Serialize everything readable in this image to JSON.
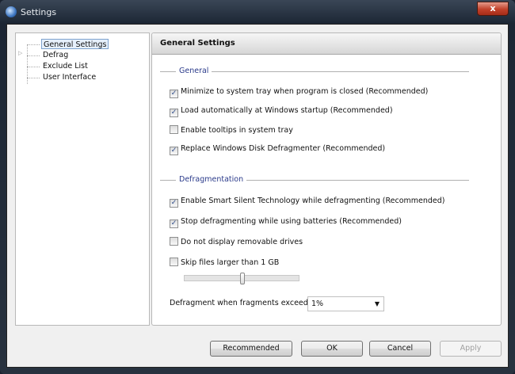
{
  "window": {
    "title": "Settings",
    "close_label": "x"
  },
  "tree": {
    "items": [
      {
        "label": "General Settings",
        "selected": true
      },
      {
        "label": "Defrag",
        "expandable": true
      },
      {
        "label": "Exclude List"
      },
      {
        "label": "User Interface"
      }
    ]
  },
  "panel": {
    "title": "General Settings",
    "general": {
      "title": "General",
      "options": [
        {
          "label": "Minimize to system tray when program is closed (Recommended)",
          "checked": true
        },
        {
          "label": "Load automatically at Windows startup (Recommended)",
          "checked": true
        },
        {
          "label": "Enable tooltips in system tray",
          "checked": false
        },
        {
          "label": "Replace Windows Disk Defragmenter (Recommended)",
          "checked": true
        }
      ]
    },
    "defrag": {
      "title": "Defragmentation",
      "options": [
        {
          "label": "Enable Smart Silent Technology while defragmenting (Recommended)",
          "checked": true
        },
        {
          "label": "Stop defragmenting while using batteries (Recommended)",
          "checked": true
        },
        {
          "label": "Do not display removable drives",
          "checked": false
        },
        {
          "label": "Skip files larger than 1 GB",
          "checked": false
        }
      ],
      "size_slider_fraction": 0.5,
      "fragments_label": "Defragment when fragments exceed:",
      "fragments_value": "1%"
    }
  },
  "buttons": {
    "recommended": "Recommended",
    "ok": "OK",
    "cancel": "Cancel",
    "apply": "Apply"
  }
}
